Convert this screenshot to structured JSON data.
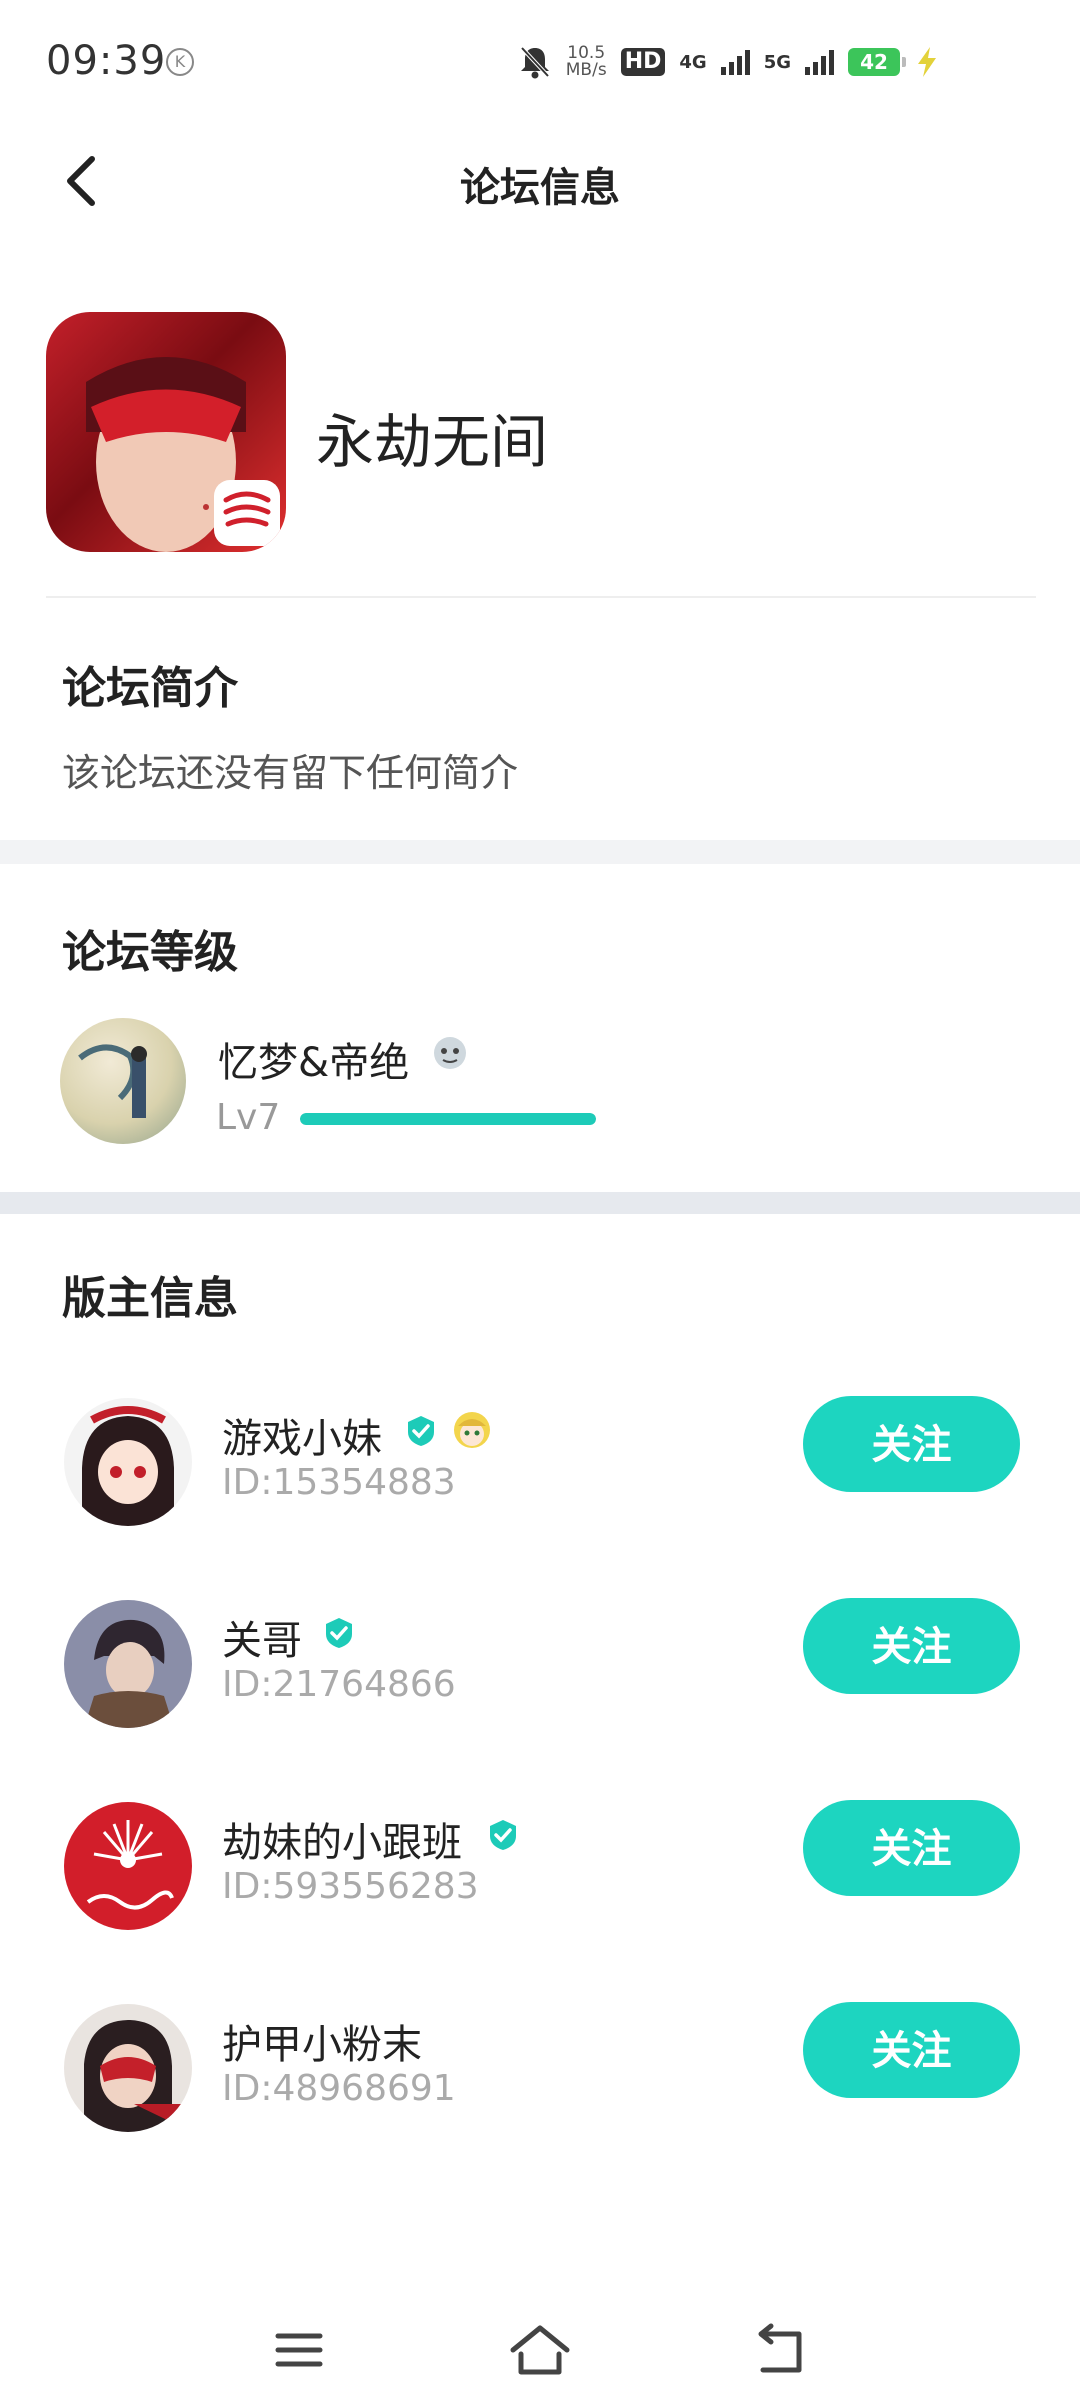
{
  "status_bar": {
    "time": "09:39",
    "k_badge": "K",
    "speed_value": "10.5",
    "speed_unit": "MB/s",
    "hd_label": "HD",
    "net1": "4G",
    "net2": "5G",
    "battery": "42",
    "icons": [
      "mute-icon",
      "signal-icon",
      "battery-icon",
      "charging-icon"
    ]
  },
  "header": {
    "title": "论坛信息",
    "back_icon": "back-arrow-icon"
  },
  "forum": {
    "name": "永劫无间"
  },
  "intro": {
    "title": "论坛简介",
    "text": "该论坛还没有留下任何简介"
  },
  "level": {
    "title": "论坛等级",
    "user_name": "忆梦&帝绝",
    "level_label": "Lv7",
    "progress_percent": 100
  },
  "moderators": {
    "title": "版主信息",
    "follow_label": "关注",
    "items": [
      {
        "name": "游戏小妹",
        "id": "ID:15354883",
        "verified": true,
        "extra_badge": true
      },
      {
        "name": "关哥",
        "id": "ID:21764866",
        "verified": true,
        "extra_badge": false
      },
      {
        "name": "劫妹的小跟班",
        "id": "ID:593556283",
        "verified": true,
        "extra_badge": false
      },
      {
        "name": "护甲小粉末",
        "id": "ID:48968691",
        "verified": false,
        "extra_badge": false
      }
    ]
  },
  "colors": {
    "accent": "#1dd5c0",
    "progress": "#1dcbb8",
    "band": "#f2f3f5"
  },
  "navbar": {
    "icons": [
      "menu-icon",
      "home-icon",
      "back-icon"
    ]
  }
}
